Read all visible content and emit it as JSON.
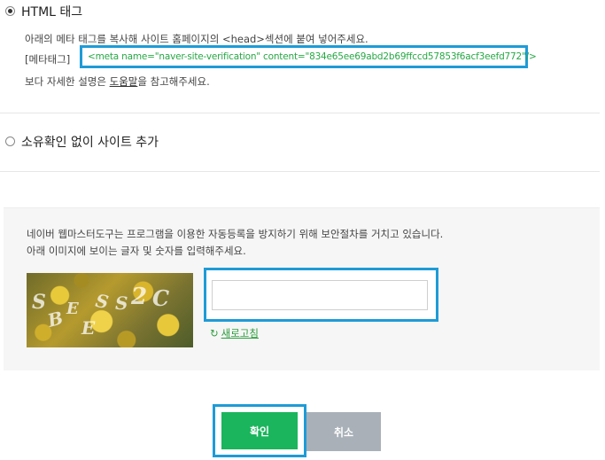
{
  "html_tag_option": {
    "label": "HTML 태그",
    "selected": true,
    "instruction": "아래의 메타 태그를 복사해 사이트 홈페이지의 <head>섹션에 붙여 넣어주세요.",
    "meta_prefix": "[메타태그]",
    "meta_code": "<meta name=\"naver-site-verification\" content=\"834e65ee69abd2b69ffccd57853f6acf3eefd772\"/>",
    "help_prefix": "보다 자세한 설명은 ",
    "help_link": "도움말",
    "help_suffix": "을 참고해주세요."
  },
  "no_verify_option": {
    "label": "소유확인 없이 사이트 추가",
    "selected": false
  },
  "captcha": {
    "line1": "네이버 웹마스터도구는 프로그램을 이용한 자동등록을 방지하기 위해 보안절차를 거치고 있습니다.",
    "line2": "아래 이미지에 보이는 글자 및 숫자를 입력해주세요.",
    "input_value": "",
    "refresh_label": "새로고침"
  },
  "buttons": {
    "confirm": "확인",
    "cancel": "취소"
  },
  "colors": {
    "highlight": "#1e9bd7",
    "confirm": "#1ab55c",
    "cancel": "#a9b0b8",
    "meta_code": "#27a845"
  }
}
